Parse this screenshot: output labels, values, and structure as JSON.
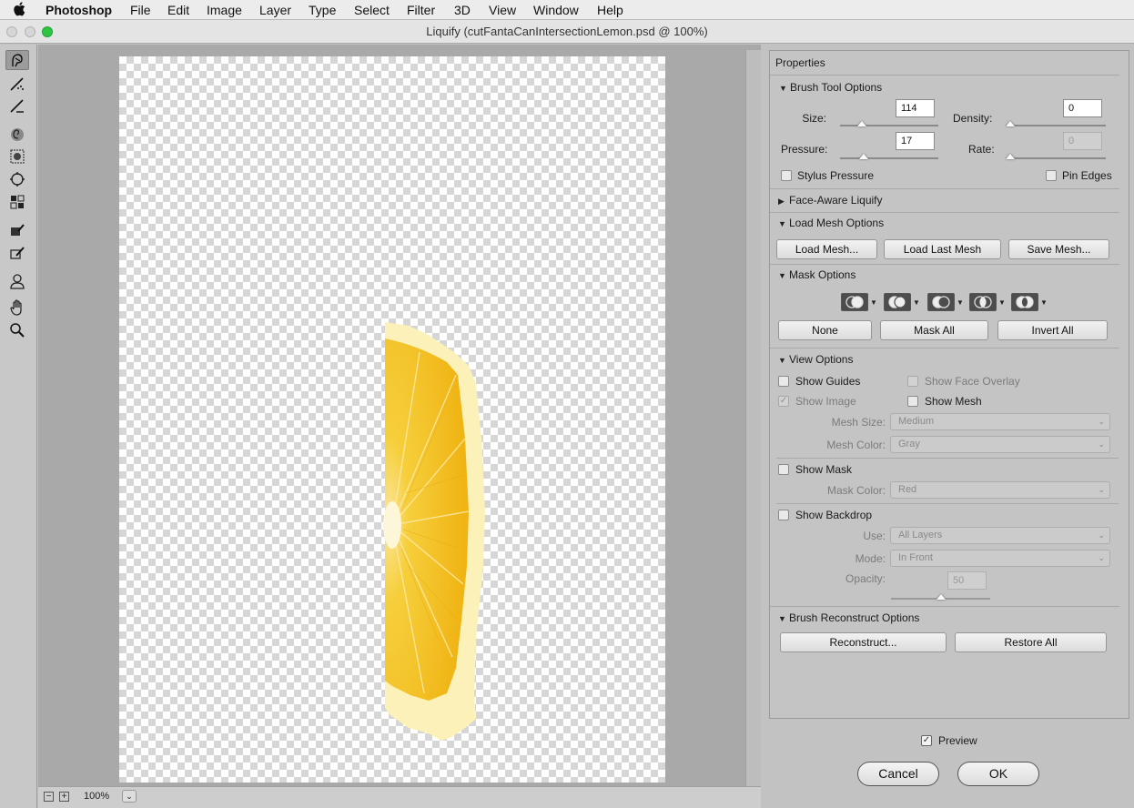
{
  "menubar": {
    "apple": "",
    "app_name": "Photoshop",
    "items": [
      "File",
      "Edit",
      "Image",
      "Layer",
      "Type",
      "Select",
      "Filter",
      "3D",
      "View",
      "Window",
      "Help"
    ]
  },
  "window": {
    "title": "Liquify (cutFantaCanIntersectionLemon.psd @ 100%)"
  },
  "tools": [
    {
      "name": "forward-warp-tool-icon",
      "selected": true
    },
    {
      "name": "reconstruct-tool-icon"
    },
    {
      "name": "smooth-tool-icon"
    },
    {
      "name": "twirl-clockwise-tool-icon"
    },
    {
      "name": "pucker-tool-icon"
    },
    {
      "name": "bloat-tool-icon"
    },
    {
      "name": "push-left-tool-icon"
    },
    {
      "name": "freeze-mask-tool-icon"
    },
    {
      "name": "thaw-mask-tool-icon"
    },
    {
      "name": "face-tool-icon"
    },
    {
      "name": "hand-tool-icon"
    },
    {
      "name": "zoom-tool-icon"
    }
  ],
  "canvas": {
    "zoom": "100%"
  },
  "properties": {
    "title": "Properties",
    "brush_tool_options": {
      "header": "Brush Tool Options",
      "size_label": "Size:",
      "size_value": "114",
      "size_fraction": 0.15,
      "density_label": "Density:",
      "density_value": "0",
      "density_fraction": 0.0,
      "pressure_label": "Pressure:",
      "pressure_value": "17",
      "pressure_fraction": 0.17,
      "rate_label": "Rate:",
      "rate_value": "0",
      "rate_fraction": 0.0,
      "stylus_pressure_label": "Stylus Pressure",
      "pin_edges_label": "Pin Edges"
    },
    "face_aware": {
      "header": "Face-Aware Liquify"
    },
    "load_mesh": {
      "header": "Load Mesh Options",
      "load_mesh": "Load Mesh...",
      "load_last_mesh": "Load Last Mesh",
      "save_mesh": "Save Mesh..."
    },
    "mask_options": {
      "header": "Mask Options",
      "none": "None",
      "mask_all": "Mask All",
      "invert_all": "Invert All"
    },
    "view_options": {
      "header": "View Options",
      "show_guides": "Show Guides",
      "show_face_overlay": "Show Face Overlay",
      "show_image": "Show Image",
      "show_mesh": "Show Mesh",
      "mesh_size_label": "Mesh Size:",
      "mesh_size_value": "Medium",
      "mesh_color_label": "Mesh Color:",
      "mesh_color_value": "Gray",
      "show_mask": "Show Mask",
      "mask_color_label": "Mask Color:",
      "mask_color_value": "Red",
      "show_backdrop": "Show Backdrop",
      "use_label": "Use:",
      "use_value": "All Layers",
      "mode_label": "Mode:",
      "mode_value": "In Front",
      "opacity_label": "Opacity:",
      "opacity_value": "50",
      "opacity_fraction": 0.5
    },
    "reconstruct": {
      "header": "Brush Reconstruct Options",
      "reconstruct": "Reconstruct...",
      "restore_all": "Restore All"
    }
  },
  "footer": {
    "preview_label": "Preview",
    "cancel": "Cancel",
    "ok": "OK"
  },
  "colors": {
    "lemon_pulp": "#f5c21c",
    "lemon_rind": "#fdf3c0",
    "traffic_green": "#2ec543"
  }
}
